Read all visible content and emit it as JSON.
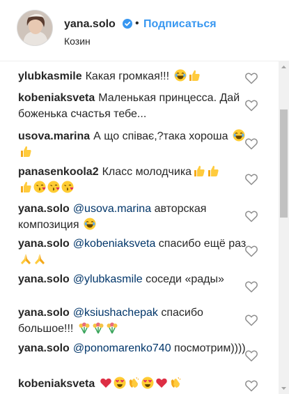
{
  "header": {
    "username": "yana.solo",
    "separator": "•",
    "follow_label": "Подписаться",
    "location": "Козин",
    "verified_color": "#3897f0",
    "follow_color": "#3897f0"
  },
  "comments": [
    {
      "author": "ylubkasmile",
      "text": "Какая громкая!!!",
      "emoji": [
        "joy",
        "thumbs-up"
      ]
    },
    {
      "author": "kobeniaksveta",
      "text": "Маленькая принцесса. Дай боженька счастья тебе...",
      "emoji": []
    },
    {
      "author": "usova.marina",
      "text": "А що співає,?така хороша",
      "emoji": [
        "joy",
        "thumbs-up"
      ]
    },
    {
      "author": "panasenkoola2",
      "text": "Класс молодчика",
      "emoji": [
        "thumbs-up",
        "thumbs-up",
        "thumbs-up",
        "kiss",
        "kiss",
        "kiss"
      ]
    },
    {
      "author": "yana.solo",
      "mention": "@usova.marina",
      "text": "авторская композиция",
      "emoji": [
        "joy"
      ]
    },
    {
      "author": "yana.solo",
      "mention": "@kobeniaksveta",
      "text": "спасибо ещё раз",
      "emoji": [
        "pray",
        "pray"
      ]
    },
    {
      "author": "yana.solo",
      "mention": "@ylubkasmile",
      "text": "соседи «рады»",
      "emoji": []
    },
    {
      "author": "yana.solo",
      "mention": "@ksiushachepak",
      "text": "спасибо большое!!!",
      "emoji": [
        "tulip",
        "tulip",
        "tulip"
      ]
    },
    {
      "author": "yana.solo",
      "mention": "@ponomarenko740",
      "text": "посмотрим))))",
      "emoji": []
    },
    {
      "author": "kobeniaksveta",
      "text": "",
      "emoji": [
        "heart",
        "heart-eyes",
        "clap",
        "heart-eyes",
        "heart",
        "clap"
      ]
    }
  ],
  "colors": {
    "text": "#262626",
    "mention": "#003569",
    "heart_outline": "#8e8e8e"
  }
}
